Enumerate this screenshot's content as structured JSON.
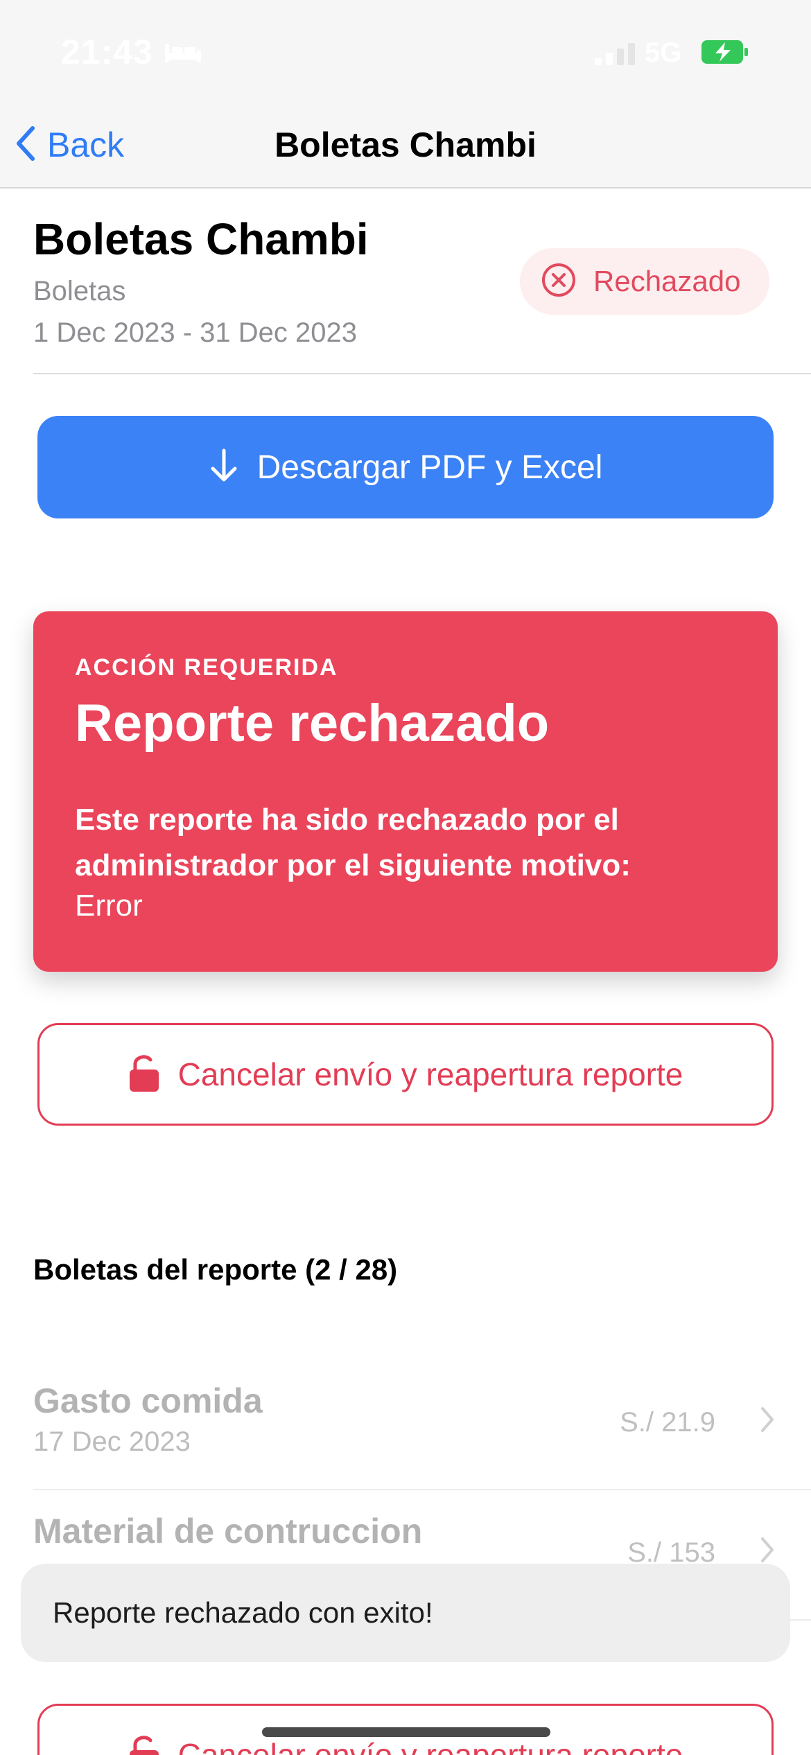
{
  "status_bar": {
    "time": "21:43",
    "network": "5G",
    "bed_icon": "bed-icon",
    "battery_icon": "battery-charging-icon"
  },
  "nav": {
    "back_label": "Back",
    "title": "Boletas Chambi",
    "back_icon": "chevron-left-icon"
  },
  "header": {
    "title": "Boletas Chambi",
    "subtitle": "Boletas",
    "date_range": "1 Dec 2023 - 31 Dec 2023",
    "status_label": "Rechazado",
    "status_icon": "x-circle-icon"
  },
  "actions": {
    "download_label": "Descargar PDF y Excel",
    "download_icon": "arrow-down-icon",
    "reopen_label": "Cancelar envío y reapertura reporte",
    "reopen_icon": "unlock-icon"
  },
  "alert": {
    "kicker": "ACCIÓN REQUERIDA",
    "title": "Reporte rechazado",
    "body": "Este reporte ha sido rechazado por el administrador por el siguiente motivo:",
    "reason": "Error"
  },
  "list": {
    "title": "Boletas del reporte (2 / 28)",
    "items": [
      {
        "title": "Gasto comida",
        "date": "17 Dec 2023",
        "amount": "S./ 21.9"
      },
      {
        "title": "Material de contruccion",
        "date": "",
        "amount": "S./ 153"
      }
    ]
  },
  "toast": {
    "message": "Reporte rechazado con exito!"
  },
  "colors": {
    "accent_blue": "#3b82f6",
    "danger": "#ea455b",
    "danger_text": "#e23d55",
    "badge_bg": "#fdeeef",
    "nav_bg": "#f6f6f6"
  }
}
